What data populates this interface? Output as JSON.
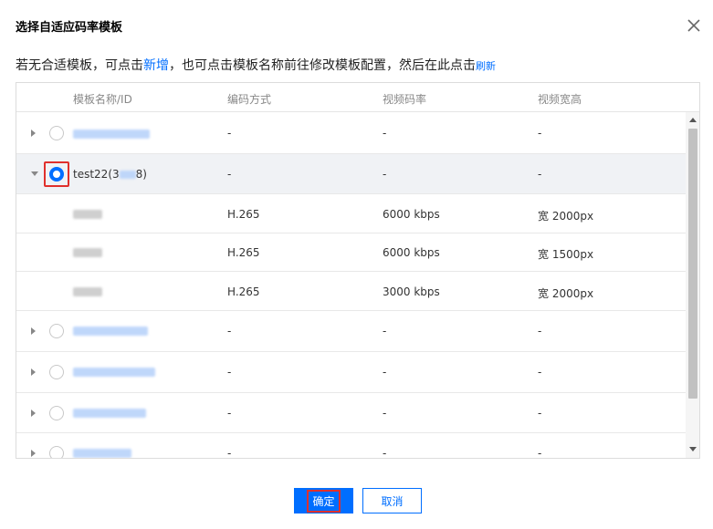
{
  "dialog": {
    "title": "选择自适应码率模板",
    "hint_prefix": "若无合适模板，可点击",
    "hint_new_link": "新增",
    "hint_middle": "，也可点击模板名称前往修改模板配置，然后在此点击",
    "hint_refresh_link": "刷新"
  },
  "table": {
    "columns": [
      "模板名称/ID",
      "编码方式",
      "视频码率",
      "视频宽高"
    ],
    "empty_value": "-",
    "selected_template": {
      "name": "test22(3",
      "name_tail": "8)",
      "sub_rows": [
        {
          "codec": "H.265",
          "bitrate": "6000 kbps",
          "size": "宽 2000px"
        },
        {
          "codec": "H.265",
          "bitrate": "6000 kbps",
          "size": "宽 1500px"
        },
        {
          "codec": "H.265",
          "bitrate": "3000 kbps",
          "size": "宽 2000px"
        }
      ]
    }
  },
  "footer": {
    "confirm_label": "确定",
    "cancel_label": "取消"
  },
  "colors": {
    "accent": "#006eff",
    "highlight": "#e0302c",
    "selected_row": "#f0f2f5"
  }
}
